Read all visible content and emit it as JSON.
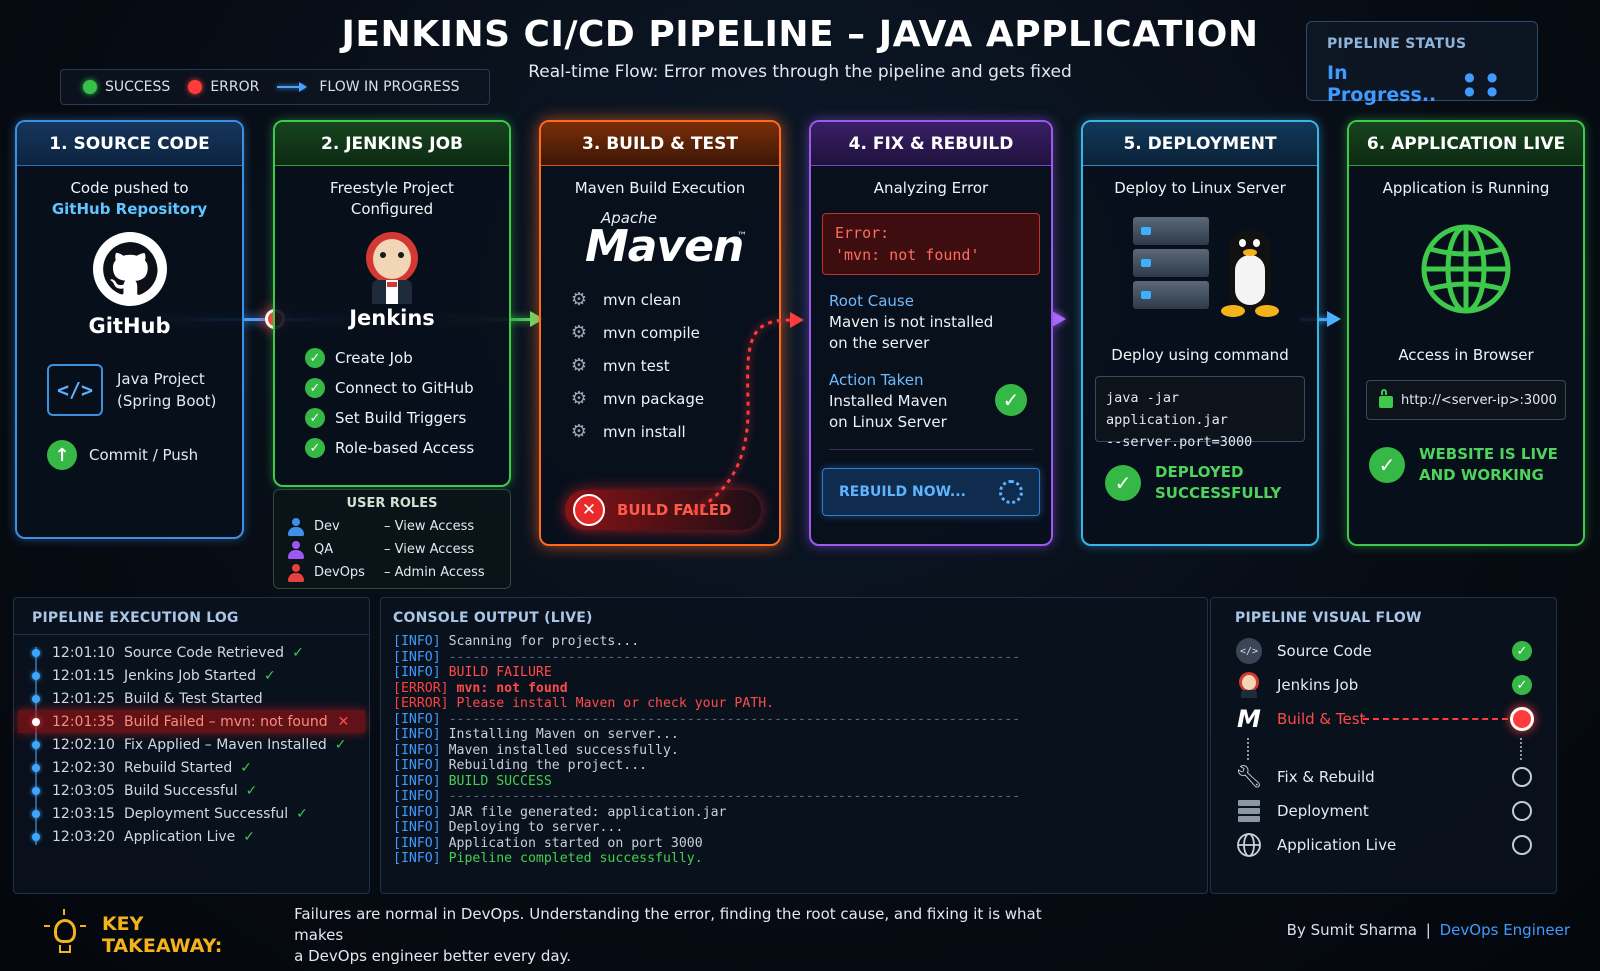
{
  "header": {
    "title": "JENKINS CI/CD PIPELINE – JAVA APPLICATION",
    "subtitle": "Real-time Flow: Error moves through the pipeline and gets fixed"
  },
  "legend": {
    "success": "SUCCESS",
    "error": "ERROR",
    "flow": "FLOW IN PROGRESS"
  },
  "status": {
    "label": "PIPELINE STATUS",
    "value": "In Progress..",
    "dots": "● ● ● ●"
  },
  "stages": {
    "source": {
      "title": "1. SOURCE CODE",
      "line1": "Code pushed to",
      "line2": "GitHub Repository",
      "brand": "GitHub",
      "project_line1": "Java Project",
      "project_line2": "(Spring Boot)",
      "commit": "Commit / Push"
    },
    "jenkins": {
      "title": "2. JENKINS JOB",
      "line1": "Freestyle Project",
      "line2": "Configured",
      "brand": "Jenkins",
      "items": [
        "Create Job",
        "Connect to GitHub",
        "Set Build Triggers",
        "Role-based Access"
      ],
      "roles_title": "USER ROLES",
      "roles": [
        {
          "name": "Dev",
          "access": "– View Access",
          "color": "#3f8fe8"
        },
        {
          "name": "QA",
          "access": "– View Access",
          "color": "#9b59f0"
        },
        {
          "name": "DevOps",
          "access": "– Admin Access",
          "color": "#e64040"
        }
      ]
    },
    "build": {
      "title": "3. BUILD & TEST",
      "subtitle": "Maven Build Execution",
      "logo_small": "Apache",
      "logo_big": "Maven",
      "logo_tm": "™",
      "steps": [
        "mvn clean",
        "mvn compile",
        "mvn test",
        "mvn package",
        "mvn install"
      ],
      "failed": "BUILD FAILED"
    },
    "fix": {
      "title": "4. FIX & REBUILD",
      "subtitle": "Analyzing Error",
      "error_label": "Error:",
      "error_msg": "'mvn: not found'",
      "root_label": "Root Cause",
      "root_line1": "Maven is not installed",
      "root_line2": "on the server",
      "action_label": "Action Taken",
      "action_line1": "Installed Maven",
      "action_line2": "on Linux Server",
      "rebuild": "REBUILD NOW..."
    },
    "deploy": {
      "title": "5. DEPLOYMENT",
      "subtitle": "Deploy to Linux Server",
      "using": "Deploy using command",
      "cmd1": "java -jar application.jar",
      "cmd2": "--server.port=3000",
      "done_line1": "DEPLOYED",
      "done_line2": "SUCCESSFULLY"
    },
    "live": {
      "title": "6. APPLICATION LIVE",
      "subtitle": "Application is Running",
      "access": "Access in Browser",
      "url": "http://<server-ip>:3000",
      "done_line1": "WEBSITE IS LIVE",
      "done_line2": "AND WORKING"
    }
  },
  "log": {
    "title": "PIPELINE EXECUTION LOG",
    "rows": [
      {
        "time": "12:01:10",
        "text": "Source Code Retrieved",
        "ok": true
      },
      {
        "time": "12:01:15",
        "text": "Jenkins Job Started",
        "ok": true
      },
      {
        "time": "12:01:25",
        "text": "Build & Test Started",
        "ok": false,
        "mark": ""
      },
      {
        "time": "12:01:35",
        "text": "Build Failed – mvn: not found",
        "ok": false,
        "mark": "✕",
        "error": true
      },
      {
        "time": "12:02:10",
        "text": "Fix Applied – Maven Installed",
        "ok": true
      },
      {
        "time": "12:02:30",
        "text": "Rebuild Started",
        "ok": true
      },
      {
        "time": "12:03:05",
        "text": "Build Successful",
        "ok": true
      },
      {
        "time": "12:03:15",
        "text": "Deployment Successful",
        "ok": true
      },
      {
        "time": "12:03:20",
        "text": "Application Live",
        "ok": true
      }
    ]
  },
  "console": {
    "title": "CONSOLE OUTPUT (LIVE)",
    "lines": [
      {
        "tag": "[INFO]",
        "kind": "info",
        "text": "Scanning for projects...",
        "style": "text"
      },
      {
        "tag": "[INFO]",
        "kind": "info",
        "text": "------------------------------------------------------------------------",
        "style": "dash"
      },
      {
        "tag": "[INFO]",
        "kind": "info",
        "text": "BUILD FAILURE",
        "style": "red"
      },
      {
        "tag": "[ERROR]",
        "kind": "err",
        "text": "mvn: not found",
        "style": "redbold"
      },
      {
        "tag": "[ERROR]",
        "kind": "err",
        "text": "Please install Maven or check your PATH.",
        "style": "red"
      },
      {
        "tag": "[INFO]",
        "kind": "info",
        "text": "------------------------------------------------------------------------",
        "style": "dash"
      },
      {
        "tag": "[INFO]",
        "kind": "info",
        "text": "Installing Maven on server...",
        "style": "text"
      },
      {
        "tag": "[INFO]",
        "kind": "info",
        "text": "Maven installed successfully.",
        "style": "text"
      },
      {
        "tag": "[INFO]",
        "kind": "info",
        "text": "Rebuilding the project...",
        "style": "text"
      },
      {
        "tag": "[INFO]",
        "kind": "info",
        "text": "BUILD SUCCESS",
        "style": "green"
      },
      {
        "tag": "[INFO]",
        "kind": "info",
        "text": "------------------------------------------------------------------------",
        "style": "dash"
      },
      {
        "tag": "[INFO]",
        "kind": "info",
        "text": "JAR file generated: application.jar",
        "style": "text"
      },
      {
        "tag": "[INFO]",
        "kind": "info",
        "text": "Deploying to server...",
        "style": "text"
      },
      {
        "tag": "[INFO]",
        "kind": "info",
        "text": "Application started on port 3000",
        "style": "text"
      },
      {
        "tag": "[INFO]",
        "kind": "info",
        "text": "Pipeline completed successfully.",
        "style": "green"
      }
    ]
  },
  "visual_flow": {
    "title": "PIPELINE VISUAL FLOW",
    "items": [
      {
        "label": "Source Code",
        "icon": "code-icon",
        "state": "done"
      },
      {
        "label": "Jenkins Job",
        "icon": "jenkins-icon",
        "state": "done"
      },
      {
        "label": "Build & Test",
        "icon": "maven-icon",
        "state": "error"
      },
      {
        "label": "Fix & Rebuild",
        "icon": "wrench-icon",
        "state": "pending"
      },
      {
        "label": "Deployment",
        "icon": "server-icon",
        "state": "pending"
      },
      {
        "label": "Application Live",
        "icon": "globe-icon",
        "state": "pending"
      }
    ]
  },
  "footer": {
    "takeaway_label": "KEY TAKEAWAY:",
    "takeaway_line1": "Failures are normal in DevOps. Understanding the error, finding the root cause, and fixing it is what makes",
    "takeaway_line2": "a DevOps engineer better every day.",
    "author": "By Sumit Sharma",
    "separator": "|",
    "role": "DevOps Engineer"
  },
  "colors": {
    "success": "#35c24a",
    "error": "#ff3b3b",
    "flow": "#49a3ff"
  }
}
